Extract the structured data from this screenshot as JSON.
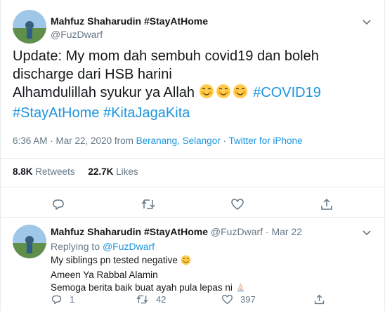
{
  "main_tweet": {
    "author_name": "Mahfuz Shaharudin #StayAtHome",
    "author_handle": "@FuzDwarf",
    "text_line1": "Update: My mom dah sembuh covid19 dan boleh",
    "text_line2": "discharge dari HSB harini",
    "text_line3": "Alhamdulillah syukur ya Allah",
    "hashtag_covid": "#COVID19",
    "hashtag_stay": "#StayAtHome",
    "hashtag_kita": "#KitaJagaKita",
    "timestamp": "6:36 AM · Mar 22, 2020",
    "from_label": "from",
    "location": "Beranang, Selangor",
    "separator": "·",
    "client": "Twitter for iPhone",
    "retweets_count": "8.8K",
    "retweets_label": "Retweets",
    "likes_count": "22.7K",
    "likes_label": "Likes"
  },
  "reply_tweet": {
    "author_name": "Mahfuz Shaharudin #StayAtHome",
    "author_handle": "@FuzDwarf",
    "dot": "·",
    "date": "Mar 22",
    "replying_label": "Replying to",
    "replying_handle": "@FuzDwarf",
    "line1": "My siblings pn tested negative",
    "line2": "Ameen Ya Rabbal Alamin",
    "line3": "Semoga berita baik buat ayah pula lepas ni",
    "reply_count": "1",
    "retweet_count": "42",
    "like_count": "397"
  },
  "icons": {
    "caret": "chevron-down-icon",
    "reply": "reply-icon",
    "retweet": "retweet-icon",
    "like": "heart-icon",
    "share": "share-icon",
    "emoji": "smiling-face-emoji",
    "pray": "folded-hands-emoji"
  },
  "colors": {
    "link": "#1b95e0",
    "text": "#14171a",
    "muted": "#657786",
    "border": "#e6ecf0"
  }
}
